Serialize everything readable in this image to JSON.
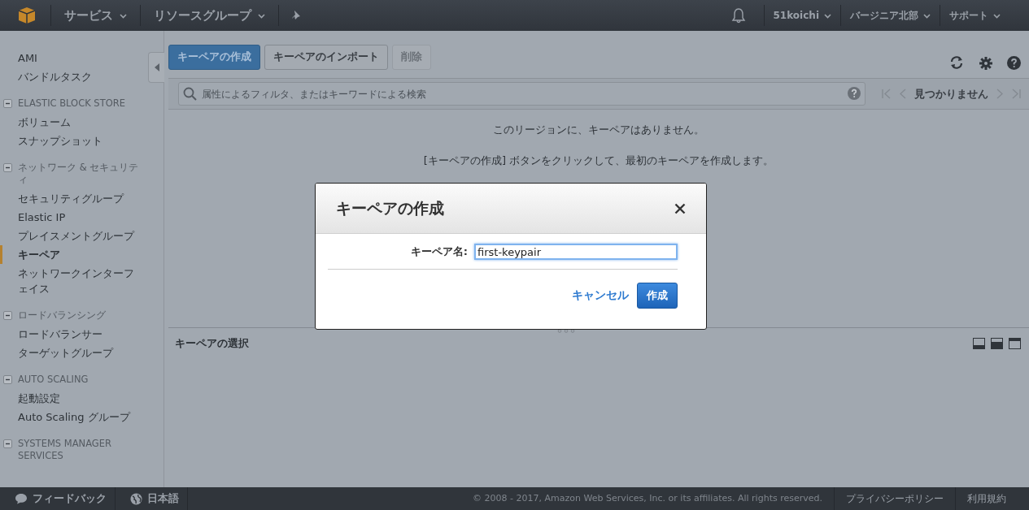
{
  "topbar": {
    "menus": [
      {
        "label": "サービス"
      },
      {
        "label": "リソースグループ"
      }
    ],
    "right_menus": [
      {
        "label": "51koichi"
      },
      {
        "label": "バージニア北部"
      },
      {
        "label": "サポート"
      }
    ]
  },
  "sidebar": {
    "items": [
      {
        "label": "AMI",
        "selected": false
      },
      {
        "label": "バンドルタスク",
        "selected": false
      }
    ],
    "sections": [
      {
        "title": "ELASTIC BLOCK STORE",
        "expanded": true,
        "items": [
          {
            "label": "ボリューム",
            "selected": false
          },
          {
            "label": "スナップショット",
            "selected": false
          }
        ]
      },
      {
        "title": "ネットワーク & セキュリティ",
        "expanded": true,
        "items": [
          {
            "label": "セキュリティグループ",
            "selected": false
          },
          {
            "label": "Elastic IP",
            "selected": false
          },
          {
            "label": "プレイスメントグループ",
            "selected": false
          },
          {
            "label": "キーペア",
            "selected": true
          },
          {
            "label": "ネットワークインターフェイス",
            "selected": false
          }
        ]
      },
      {
        "title": "ロードバランシング",
        "expanded": true,
        "items": [
          {
            "label": "ロードバランサー",
            "selected": false
          },
          {
            "label": "ターゲットグループ",
            "selected": false
          }
        ]
      },
      {
        "title": "AUTO SCALING",
        "expanded": true,
        "items": [
          {
            "label": "起動設定",
            "selected": false
          },
          {
            "label": "Auto Scaling グループ",
            "selected": false
          }
        ]
      },
      {
        "title": "SYSTEMS MANAGER SERVICES",
        "expanded": true
      }
    ]
  },
  "toolbar": {
    "buttons": [
      {
        "label": "キーペアの作成",
        "kind": "primary",
        "disabled": false
      },
      {
        "label": "キーペアのインポート",
        "kind": "default",
        "disabled": false
      },
      {
        "label": "削除",
        "kind": "default",
        "disabled": true
      }
    ]
  },
  "search": {
    "placeholder": "属性によるフィルタ、またはキーワードによる検索"
  },
  "pager": {
    "status": "見つかりません"
  },
  "empty_state": {
    "message": "このリージョンに、キーペアはありません。",
    "hint": "[キーペアの作成] ボタンをクリックして、最初のキーペアを作成します。"
  },
  "detail_panel": {
    "title": "キーペアの選択"
  },
  "dialog": {
    "title": "キーペアの作成",
    "field_label": "キーペア名:",
    "field_value": "first-keypair",
    "cancel": "キャンセル",
    "submit": "作成"
  },
  "footer": {
    "feedback": "フィードバック",
    "language": "日本語",
    "copyright": "© 2008 - 2017, Amazon Web Services, Inc. or its affiliates. All rights reserved.",
    "links": [
      "プライバシーポリシー",
      "利用規約"
    ]
  }
}
